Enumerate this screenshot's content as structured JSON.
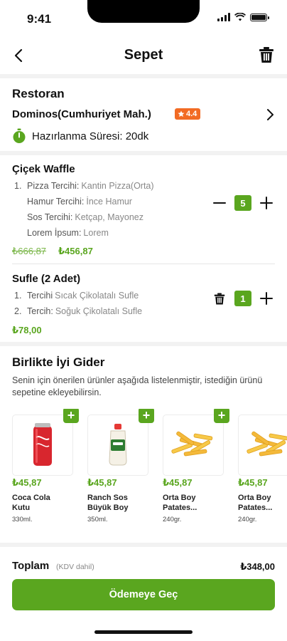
{
  "status_bar": {
    "time": "9:41"
  },
  "header": {
    "title": "Sepet"
  },
  "restaurant": {
    "section_title": "Restoran",
    "name": "Dominos(Cumhuriyet Mah.)",
    "rating": "4.4",
    "prep_label": "Hazırlanma Süresi: 20dk"
  },
  "cart_items": [
    {
      "title": "Çiçek Waffle",
      "options": [
        {
          "num": "1.",
          "key": "Pizza Tercihi:",
          "value": "Kantin Pizza(Orta)"
        },
        {
          "num": "",
          "key": "Hamur Tercihi:",
          "value": "İnce Hamur"
        },
        {
          "num": "",
          "key": "Sos Tercihi:",
          "value": "Ketçap, Mayonez"
        },
        {
          "num": "",
          "key": "Lorem İpsum:",
          "value": "Lorem"
        }
      ],
      "old_price": "₺666,87",
      "price": "₺456,87",
      "quantity": "5"
    },
    {
      "title": "Sufle (2 Adet)",
      "options": [
        {
          "num": "1.",
          "key": "Tercihi",
          "value": "Sıcak Çikolatalı Sufle"
        },
        {
          "num": "2.",
          "key": "Tercih:",
          "value": "Soğuk Çikolatalı Sufle"
        }
      ],
      "price": "₺78,00",
      "quantity": "1"
    }
  ],
  "suggestions": {
    "title": "Birlikte İyi Gider",
    "description": "Senin için önerilen ürünler aşağıda listelenmiştir, istediğin ürünü sepetine ekleyebilirsin.",
    "add_label": "+",
    "items": [
      {
        "price": "₺45,87",
        "name": "Coca Cola Kutu",
        "sub": "330ml.",
        "icon": "cola-can-icon"
      },
      {
        "price": "₺45,87",
        "name": "Ranch Sos Büyük Boy",
        "sub": "350ml.",
        "icon": "sauce-bottle-icon"
      },
      {
        "price": "₺45,87",
        "name": "Orta Boy Patates...",
        "sub": "240gr.",
        "icon": "fries-icon"
      },
      {
        "price": "₺45,87",
        "name": "Orta Boy Patates...",
        "sub": "240gr.",
        "icon": "fries-icon"
      }
    ]
  },
  "footer": {
    "total_label": "Toplam",
    "total_note": "(KDV dahil)",
    "total_value": "₺348,00",
    "pay_button": "Ödemeye Geç"
  },
  "colors": {
    "accent": "#5aa61f",
    "rating_badge": "#f26b24"
  }
}
